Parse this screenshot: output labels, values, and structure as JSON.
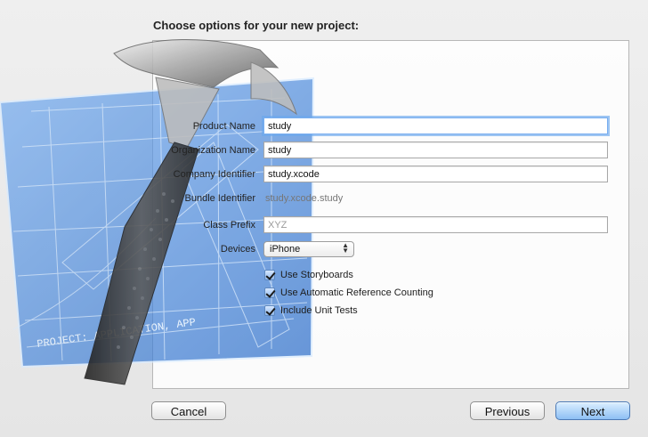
{
  "dialog": {
    "title": "Choose options for your new project:"
  },
  "form": {
    "product_name": {
      "label": "Product Name",
      "value": "study"
    },
    "organization_name": {
      "label": "Organization Name",
      "value": "study"
    },
    "company_identifier": {
      "label": "Company Identifier",
      "value": "study.xcode"
    },
    "bundle_identifier": {
      "label": "Bundle Identifier",
      "value": "study.xcode.study"
    },
    "class_prefix": {
      "label": "Class Prefix",
      "placeholder": "XYZ",
      "value": ""
    },
    "devices": {
      "label": "Devices",
      "value": "iPhone"
    },
    "checkboxes": [
      {
        "label": "Use Storyboards",
        "checked": true
      },
      {
        "label": "Use Automatic Reference Counting",
        "checked": true
      },
      {
        "label": "Include Unit Tests",
        "checked": true
      }
    ]
  },
  "buttons": {
    "cancel": "Cancel",
    "previous": "Previous",
    "next": "Next"
  },
  "artwork": {
    "description_icon": "xcode-hammer-blueprint-icon",
    "blueprint_text": "PROJECT: APPLICATION, APP"
  },
  "colors": {
    "accent": "#78aef0",
    "blueprint": "#3f82d8",
    "hammer": "#3b3b3b"
  }
}
